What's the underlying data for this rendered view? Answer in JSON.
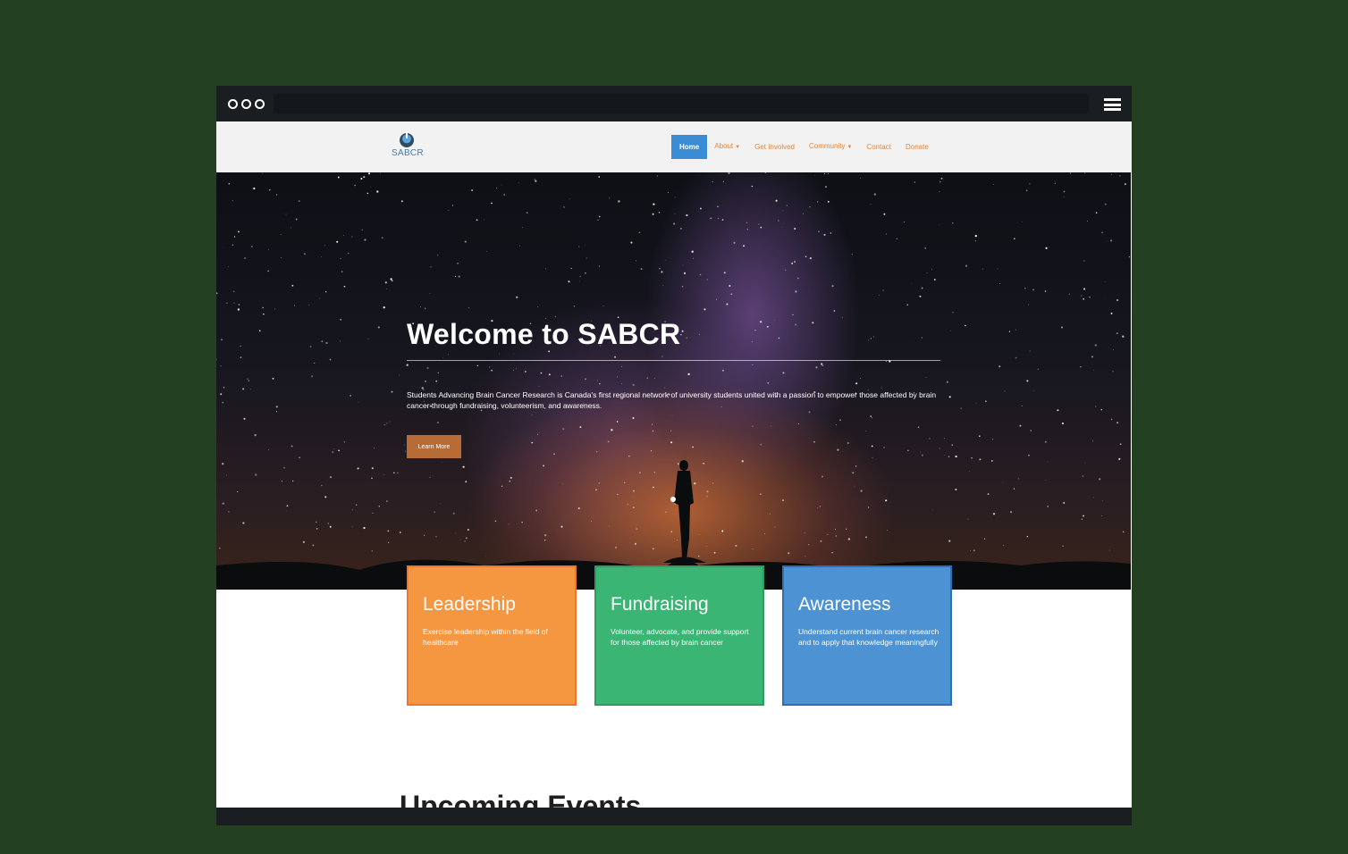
{
  "site": {
    "logo_text": "SABCR",
    "nav": [
      {
        "label": "Home",
        "active": true,
        "dropdown": false
      },
      {
        "label": "About",
        "active": false,
        "dropdown": true
      },
      {
        "label": "Get Involved",
        "active": false,
        "dropdown": false
      },
      {
        "label": "Community",
        "active": false,
        "dropdown": true
      },
      {
        "label": "Contact",
        "active": false,
        "dropdown": false
      },
      {
        "label": "Donate",
        "active": false,
        "dropdown": false
      }
    ]
  },
  "hero": {
    "title": "Welcome to SABCR",
    "description": "Students Advancing Brain Cancer Research is Canada's first regional network of university students united with a passion to empower those affected by brain cancer through fundraising, volunteerism, and awareness.",
    "button_label": "Learn More"
  },
  "cards": [
    {
      "title": "Leadership",
      "text": "Exercise leadership within the field of healthcare",
      "color": "#f59641"
    },
    {
      "title": "Fundraising",
      "text": "Volunteer, advocate, and provide support for those affected by brain cancer",
      "color": "#3ab574"
    },
    {
      "title": "Awareness",
      "text": "Understand current brain cancer research and to apply that knowledge meaningfully",
      "color": "#4d93d3"
    }
  ],
  "events_heading": "Upcoming Events",
  "colors": {
    "page_bg": "#244022",
    "nav_accent": "#e0873f",
    "nav_active": "#3a8dd4",
    "button": "#b86c35"
  }
}
